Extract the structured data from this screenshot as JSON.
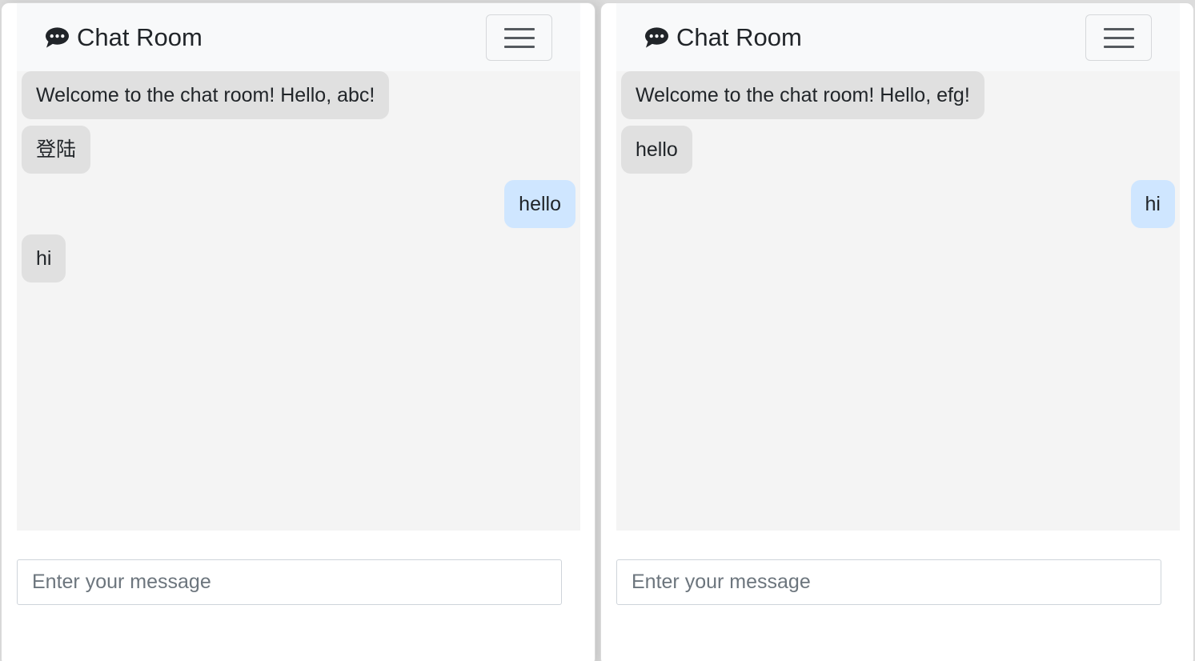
{
  "windows": [
    {
      "brand": "Chat Room",
      "brand_icon": "chat-bubble-icon",
      "menu_icon": "hamburger-menu-icon",
      "messages": [
        {
          "text": "Welcome to the chat room! Hello, abc!",
          "side": "received"
        },
        {
          "text": "登陆",
          "side": "received"
        },
        {
          "text": "hello",
          "side": "sent"
        },
        {
          "text": "hi",
          "side": "received"
        }
      ],
      "input": {
        "placeholder": "Enter your message",
        "value": ""
      }
    },
    {
      "brand": "Chat Room",
      "brand_icon": "chat-bubble-icon",
      "menu_icon": "hamburger-menu-icon",
      "messages": [
        {
          "text": "Welcome to the chat room! Hello, efg!",
          "side": "received"
        },
        {
          "text": "hello",
          "side": "received"
        },
        {
          "text": "hi",
          "side": "sent"
        }
      ],
      "input": {
        "placeholder": "Enter your message",
        "value": ""
      }
    }
  ],
  "colors": {
    "navbar_bg": "#f8f9fa",
    "messages_bg": "#f4f4f4",
    "received_bubble": "#e0e0e0",
    "sent_bubble": "#cfe6ff",
    "text": "#212529"
  }
}
